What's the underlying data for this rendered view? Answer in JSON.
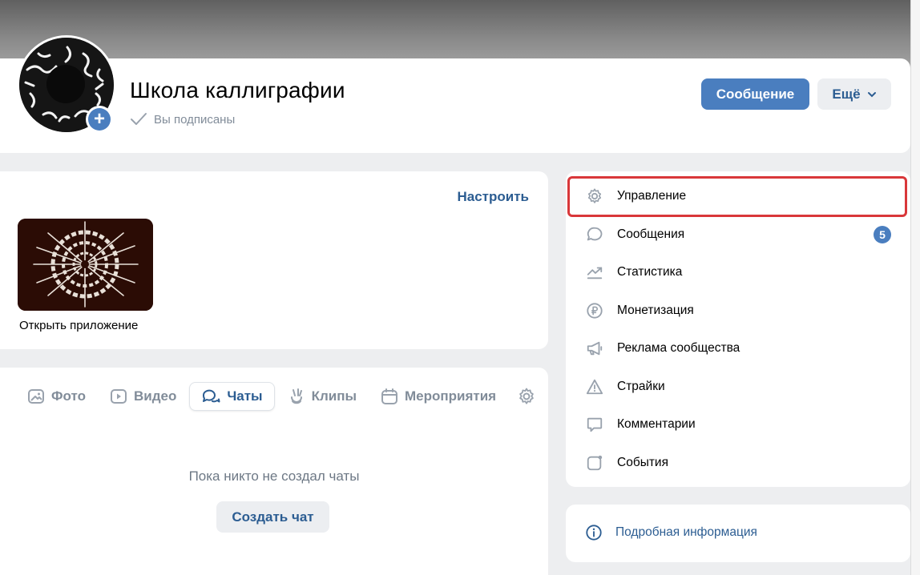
{
  "group": {
    "title": "Школа каллиграфии",
    "subscribed_label": "Вы подписаны"
  },
  "actions": {
    "message_label": "Сообщение",
    "more_label": "Ещё"
  },
  "apps_card": {
    "setup_label": "Настроить",
    "app_label": "Открыть приложение"
  },
  "tabs": [
    {
      "label": "Фото",
      "icon": "photo-icon"
    },
    {
      "label": "Видео",
      "icon": "video-icon"
    },
    {
      "label": "Чаты",
      "icon": "chats-icon",
      "active": true
    },
    {
      "label": "Клипы",
      "icon": "clips-icon"
    },
    {
      "label": "Мероприятия",
      "icon": "calendar-icon"
    }
  ],
  "chats": {
    "empty_text": "Пока никто не создал чаты",
    "create_label": "Создать чат"
  },
  "menu": {
    "items": [
      {
        "label": "Управление",
        "icon": "gear-icon"
      },
      {
        "label": "Сообщения",
        "icon": "message-bubble-icon",
        "badge": "5"
      },
      {
        "label": "Статистика",
        "icon": "trend-icon"
      },
      {
        "label": "Монетизация",
        "icon": "ruble-icon"
      },
      {
        "label": "Реклама сообщества",
        "icon": "megaphone-icon"
      },
      {
        "label": "Страйки",
        "icon": "warning-icon"
      },
      {
        "label": "Комментарии",
        "icon": "comment-icon"
      },
      {
        "label": "События",
        "icon": "events-icon"
      }
    ]
  },
  "info": {
    "label": "Подробная информация"
  },
  "colors": {
    "accent": "#4a7ebf",
    "link": "#2c5d92",
    "highlight": "#d9373a"
  }
}
